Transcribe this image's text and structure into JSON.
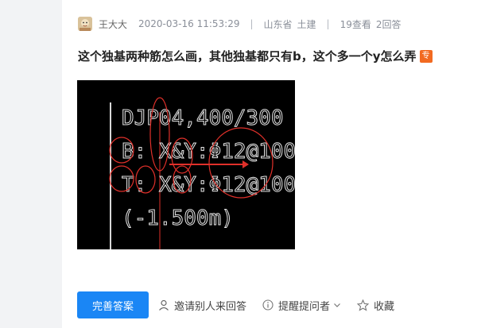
{
  "post": {
    "author": "王大大",
    "datetime": "2020-03-16 11:53:29",
    "separator": "|",
    "region": "山东省",
    "category": "土建",
    "views": "19查看",
    "answers": "2回答",
    "title": "这个独基两种筋怎么画，其他独基都只有b，这个多一个y怎么弄",
    "badge": "专",
    "badge_color": "#f26a21"
  },
  "figure": {
    "lines": [
      "DJP04,400/300",
      "B: X&Y:Φ12@100",
      "T: X&Y:Φ12@100",
      "(-1.500m)"
    ],
    "background": "#000000",
    "annotation_color": "#e0302a"
  },
  "actions": {
    "primary_label": "完善答案",
    "invite_label": "邀请别人来回答",
    "remind_label": "提醒提问者",
    "collect_label": "收藏",
    "accent": "#1a86f5"
  }
}
